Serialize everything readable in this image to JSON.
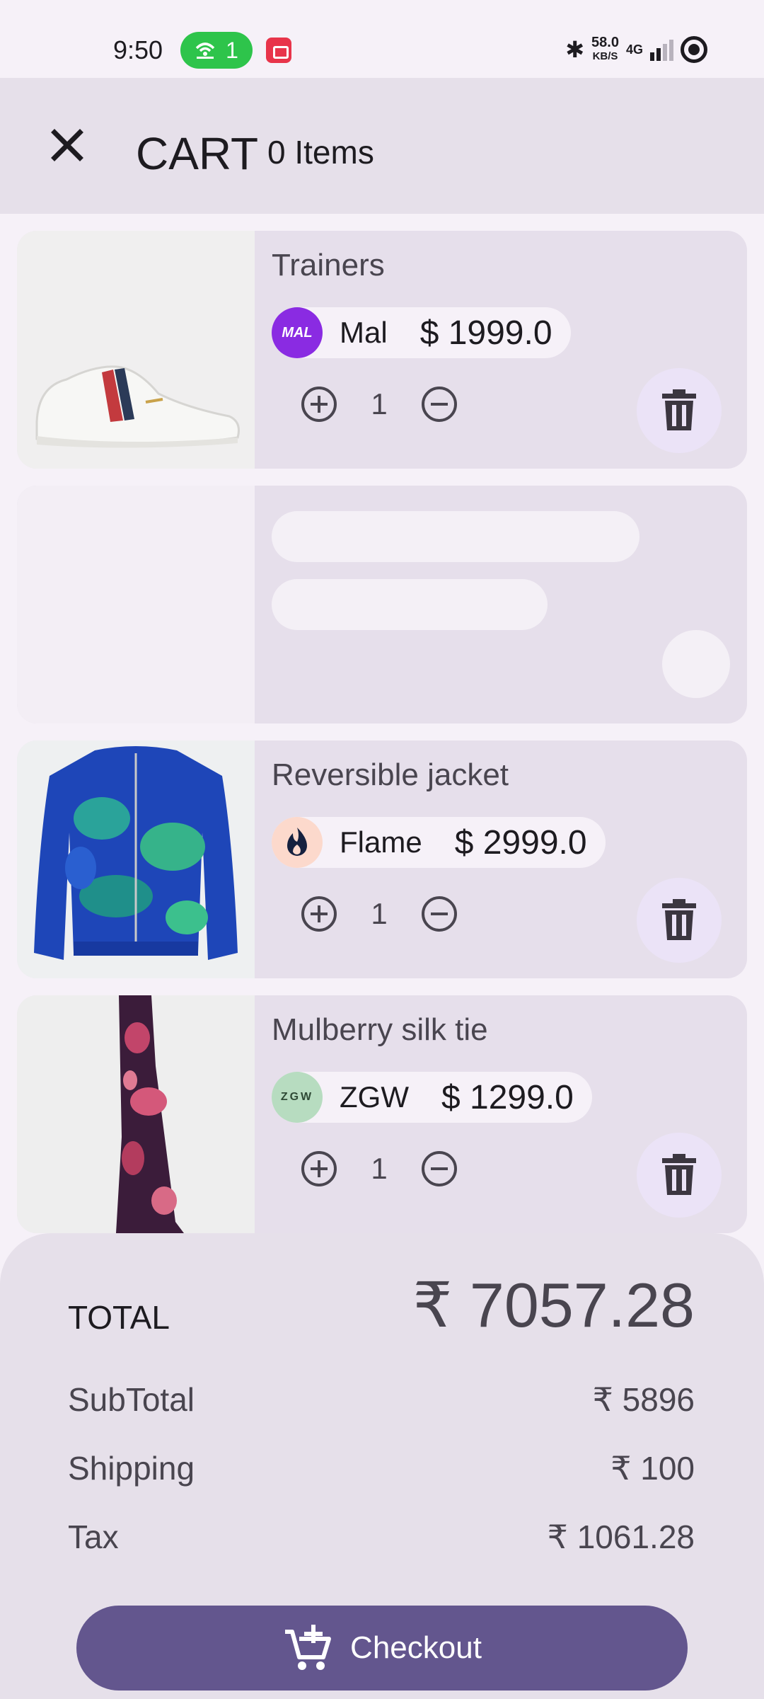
{
  "status_bar": {
    "time": "9:50",
    "hotspot_count": "1",
    "speed_value": "58.0",
    "speed_unit": "KB/S",
    "network": "4G"
  },
  "header": {
    "title": "CART",
    "item_count": "0 Items"
  },
  "cart_items": [
    {
      "name": "Trainers",
      "brand": "Mal",
      "brand_logo_text": "MAL",
      "brand_color": "#8a2be2",
      "price": "$ 1999.0",
      "quantity": "1"
    },
    {
      "name": "Reversible jacket",
      "brand": "Flame",
      "brand_logo_text": "",
      "brand_color": "#fcd9cc",
      "price": "$ 2999.0",
      "quantity": "1"
    },
    {
      "name": "Mulberry silk tie",
      "brand": "ZGW",
      "brand_logo_text": "ZGW",
      "brand_color": "#b7dcc0",
      "price": "$ 1299.0",
      "quantity": "1"
    }
  ],
  "summary": {
    "total_label": "TOTAL",
    "total_value": "₹ 7057.28",
    "subtotal_label": "SubTotal",
    "subtotal_value": "₹ 5896",
    "shipping_label": "Shipping",
    "shipping_value": "₹ 100",
    "tax_label": "Tax",
    "tax_value": "₹ 1061.28"
  },
  "checkout_label": "Checkout",
  "colors": {
    "accent": "#63568e",
    "card_bg": "#e6dfeb",
    "surface": "#f6f1f8"
  }
}
